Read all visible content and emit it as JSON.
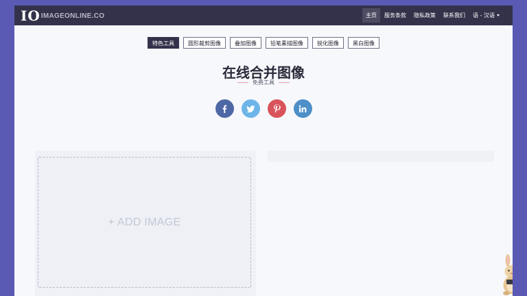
{
  "navbar": {
    "logo_mark": "IO",
    "logo_text": "IMAGEONLINE.CO",
    "links": [
      "主页",
      "服务条款",
      "隐私政策",
      "联系我们"
    ],
    "language_label": "语 - 汉语"
  },
  "tabs": [
    "特色工具",
    "圆形裁剪图像",
    "叠加图像",
    "铅笔素描图像",
    "锐化图像",
    "黑白图像"
  ],
  "page": {
    "title": "在线合并图像",
    "subtitle": "免费工具"
  },
  "social": [
    {
      "name": "facebook",
      "icon": "facebook-icon",
      "color": "#4e67a5"
    },
    {
      "name": "twitter",
      "icon": "twitter-icon",
      "color": "#6db4e8"
    },
    {
      "name": "pinterest",
      "icon": "pinterest-icon",
      "color": "#d8545a"
    },
    {
      "name": "linkedin",
      "icon": "linkedin-icon",
      "color": "#4d8fc8"
    }
  ],
  "upload": {
    "add_image_label": "+ ADD IMAGE"
  },
  "colors": {
    "navbar_bg": "#33324a",
    "page_bg": "#5a5ab4",
    "content_bg": "#f7f8fc",
    "accent_line": "#e49cb0"
  }
}
